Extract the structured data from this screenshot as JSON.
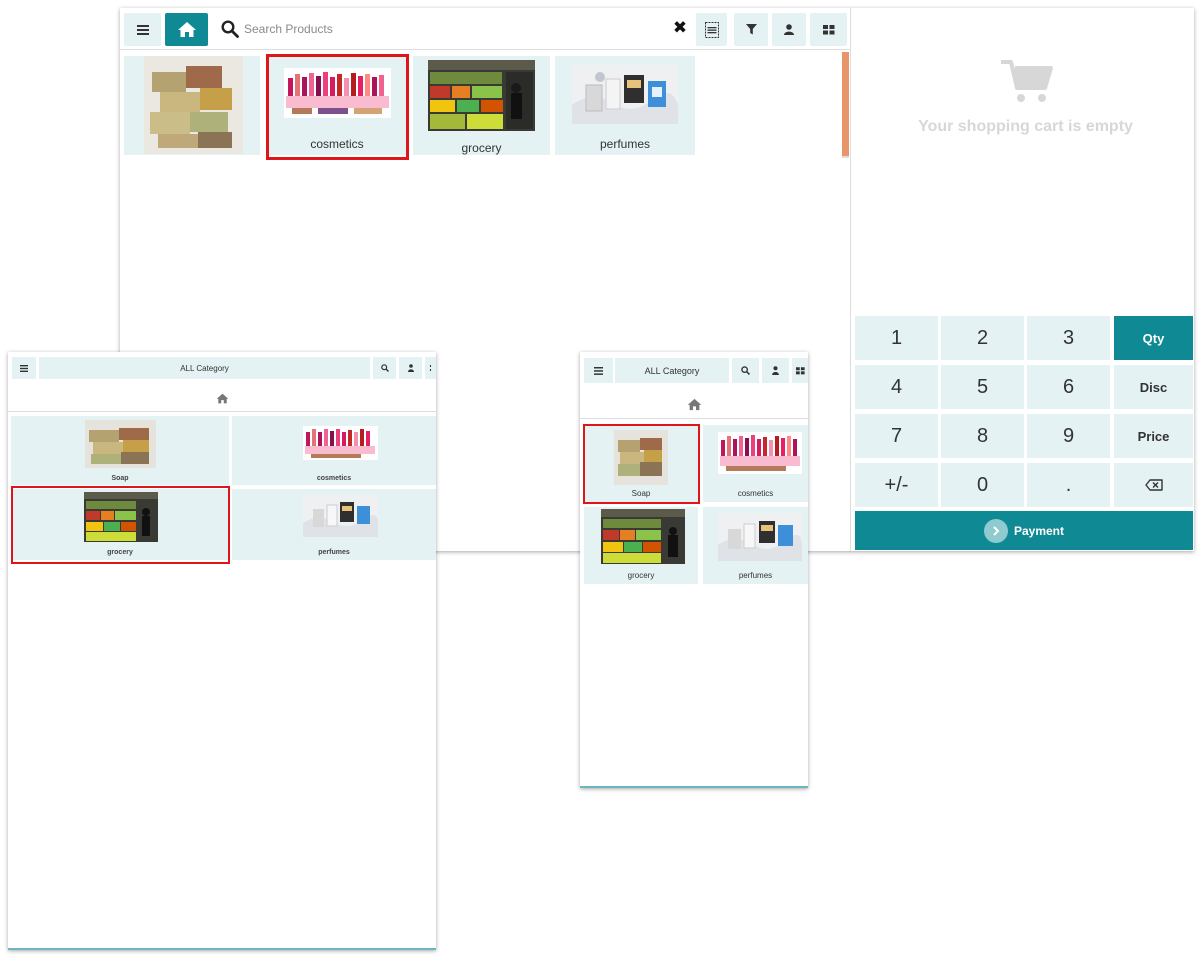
{
  "desktop": {
    "search": {
      "placeholder": "Search Products"
    },
    "clear_glyph": "✖",
    "toolbar_icons": [
      "menu-icon",
      "home-icon",
      "search-icon",
      "close-icon",
      "barcode-icon",
      "filter-icon",
      "user-icon",
      "grid-icon"
    ],
    "categories": [
      {
        "label": "",
        "icon": "soap-image"
      },
      {
        "label": "cosmetics",
        "icon": "cosmetics-image"
      },
      {
        "label": "grocery",
        "icon": "grocery-image"
      },
      {
        "label": "perfumes",
        "icon": "perfumes-image"
      }
    ],
    "selected_category": "cosmetics",
    "cart": {
      "empty_text": "Your shopping cart is empty",
      "icon": "cart-icon"
    },
    "numpad": {
      "keys": [
        "1",
        "2",
        "3",
        "4",
        "5",
        "6",
        "7",
        "8",
        "9",
        "+/-",
        "0",
        "."
      ],
      "modes": [
        "Qty",
        "Disc",
        "Price"
      ],
      "active_mode": "Qty",
      "backspace_icon": "backspace-icon",
      "payment_label": "Payment"
    },
    "colors": {
      "accent": "#0f8994",
      "tile": "#e4f2f4",
      "highlight": "#e0151b",
      "scrollbar": "#e8956b"
    }
  },
  "tablet": {
    "category_label": "ALL Category",
    "categories": [
      {
        "label": "Soap"
      },
      {
        "label": "cosmetics"
      },
      {
        "label": "grocery"
      },
      {
        "label": "perfumes"
      }
    ],
    "selected_category": "grocery"
  },
  "phone": {
    "category_label": "ALL Category",
    "categories": [
      {
        "label": "Soap"
      },
      {
        "label": "cosmetics"
      },
      {
        "label": "grocery"
      },
      {
        "label": "perfumes"
      }
    ],
    "selected_category": "Soap"
  }
}
